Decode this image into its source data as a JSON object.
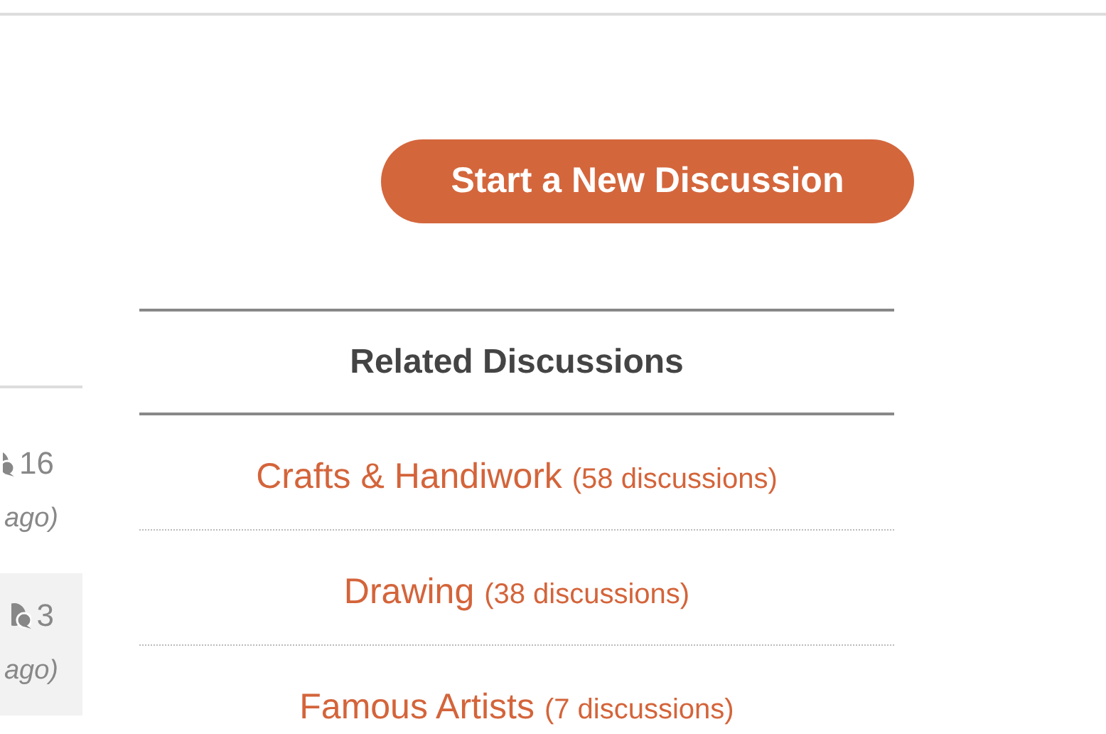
{
  "topic_list": [
    {
      "count": "16",
      "date_fragment": "ago)",
      "highlighted": false
    },
    {
      "count": "3",
      "date_fragment": "ago)",
      "highlighted": true
    }
  ],
  "new_discussion_button": "Start a New Discussion",
  "related": {
    "title": "Related Discussions",
    "items": [
      {
        "name": "Crafts & Handiwork",
        "count": "(58 discussions)"
      },
      {
        "name": "Drawing",
        "count": "(38 discussions)"
      },
      {
        "name": "Famous Artists",
        "count": "(7 discussions)"
      }
    ]
  }
}
